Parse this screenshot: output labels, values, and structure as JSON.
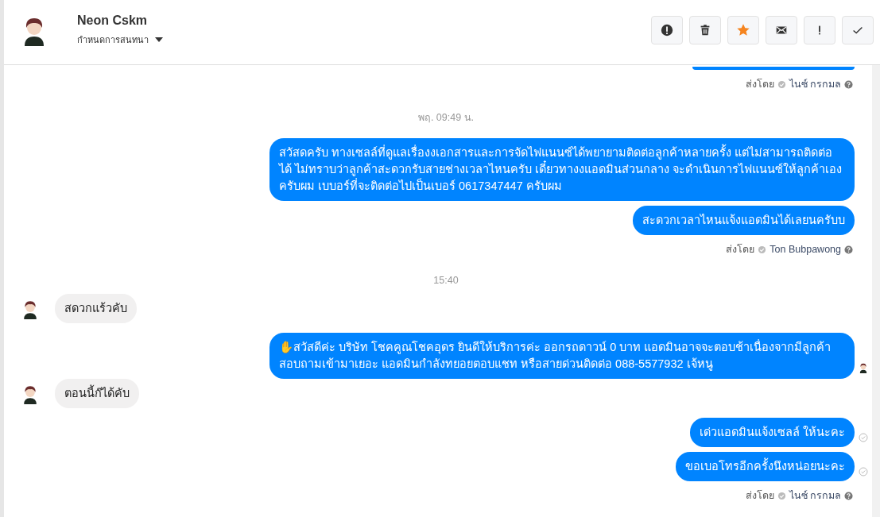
{
  "header": {
    "name": "Neon Cskm",
    "subtitle": "กำหนดการสนทนา",
    "actions": [
      {
        "kind": "report",
        "on": false
      },
      {
        "kind": "delete",
        "on": false
      },
      {
        "kind": "star",
        "on": true
      },
      {
        "kind": "mail",
        "on": false
      },
      {
        "kind": "important",
        "on": false
      },
      {
        "kind": "done",
        "on": false
      }
    ]
  },
  "messages": [
    {
      "kind": "clipped"
    },
    {
      "kind": "sent_by",
      "label": "ส่งโดย",
      "name": "ไนซ์ กรกมล"
    },
    {
      "kind": "timestamp",
      "text": "พฤ. 09:49 น."
    },
    {
      "kind": "outgoing",
      "text": "สวัสดครับ ทางเซลล์ที่ดูแลเรื่องงเอกสารและการจัดไฟแนนซ์ได้พยายามติดต่อลูกค้าหลายครั้ง แต่ไม่สามารถติดต่อได้ ไม่ทราบว่าลูกค้าสะดวกรับสายช่างเวลาไหนครับ เดี๋ยวทางงแอดมินส่วนกลาง จะดำเนินการไฟแนนซ์ให้ลูกค้าเองครับผม เบบอร์ที่จะติดต่อไปเป็นเบอร์ 0617347447 ครับผม",
      "seen_avatar": false,
      "delivered": false
    },
    {
      "kind": "outgoing",
      "text": "สะดวกเวลาไหนแจ้งแอดมินได้เลยนครับบ",
      "seen_avatar": false,
      "delivered": false
    },
    {
      "kind": "sent_by",
      "label": "ส่งโดย",
      "name": "Ton Bubpawong"
    },
    {
      "kind": "timestamp",
      "text": "15:40"
    },
    {
      "kind": "incoming",
      "text": "สดวกแร้วคับ"
    },
    {
      "kind": "outgoing",
      "text": "✋สวัสดีค่ะ บริษัท โชคคูณโชคอุดร ยินดีให้บริการค่ะ ออกรถดาวน์ 0 บาท แอดมินอาจจะตอบช้าเนื่องจากมีลูกค้าสอบถามเข้ามาเยอะ แอดมินกำลังทยอยตอบแชท หรือสายด่วนติดต่อ 088-5577932 เจ้หนู",
      "seen_avatar": true,
      "delivered": false
    },
    {
      "kind": "incoming",
      "text": "ตอนนี้ก๊ได้คับ"
    },
    {
      "kind": "outgoing",
      "text": "เด่วแอดมินแจ้งเซลล์ ให้นะคะ",
      "seen_avatar": false,
      "delivered": true
    },
    {
      "kind": "outgoing",
      "text": "ขอเบอโทรอีกครั้งนึงหน่อยนะคะ",
      "seen_avatar": false,
      "delivered": true
    },
    {
      "kind": "sent_by",
      "label": "ส่งโดย",
      "name": "ไนซ์ กรกมล"
    }
  ]
}
